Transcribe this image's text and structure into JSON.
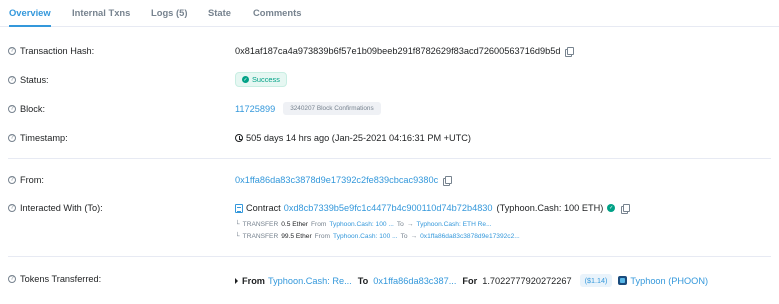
{
  "tabs": [
    {
      "label": "Overview",
      "active": true
    },
    {
      "label": "Internal Txns",
      "active": false
    },
    {
      "label": "Logs (5)",
      "active": false
    },
    {
      "label": "State",
      "active": false
    },
    {
      "label": "Comments",
      "active": false
    }
  ],
  "fields": {
    "tx_hash": {
      "label": "Transaction Hash:",
      "value": "0x81af187ca4a973839b6f57e1b09beeb291f8782629f83acd72600563716d9b5d"
    },
    "status": {
      "label": "Status:",
      "value": "Success"
    },
    "block": {
      "label": "Block:",
      "value": "11725899",
      "confirmations": "3240207 Block Confirmations"
    },
    "timestamp": {
      "label": "Timestamp:",
      "value": "505 days 14 hrs ago (Jan-25-2021 04:16:31 PM +UTC)"
    },
    "from": {
      "label": "From:",
      "value": "0x1ffa86da83c3878d9e17392c2fe839cbcac9380c"
    },
    "interacted": {
      "label": "Interacted With (To):",
      "prefix": "Contract",
      "address": "0xd8cb7339b5e9fc1c4477b4c900110d74b72b4830",
      "name": "(Typhoon.Cash: 100 ETH)"
    },
    "tokens": {
      "label": "Tokens Transferred:",
      "from_label": "From",
      "from_value": "Typhoon.Cash: Re...",
      "to_label": "To",
      "to_value": "0x1ffa86da83c387...",
      "for_label": "For",
      "amount": "1.7022777920272267",
      "usd": "($1.14)",
      "token": "Typhoon (PHOON)"
    }
  },
  "transfers": [
    {
      "kind": "TRANSFER",
      "amount": "0.5 Ether",
      "from_label": "From",
      "from": "Typhoon.Cash: 100 ...",
      "to_label": "To",
      "arrow": "→",
      "to": "Typhoon.Cash: ETH Re..."
    },
    {
      "kind": "TRANSFER",
      "amount": "99.5 Ether",
      "from_label": "From",
      "from": "Typhoon.Cash: 100 ...",
      "to_label": "To",
      "arrow": "→",
      "to": "0x1ffa86da83c3878d9e17392c2..."
    }
  ],
  "colors": {
    "accent": "#3498db",
    "success": "#00a186",
    "muted": "#77838f",
    "border": "#e7eaf3"
  },
  "icons": {
    "help": "question-circle-icon",
    "copy": "copy-icon",
    "success": "check-circle-icon",
    "clock": "clock-icon",
    "contract": "file-contract-icon",
    "verified": "verified-check-icon",
    "token": "token-logo"
  }
}
